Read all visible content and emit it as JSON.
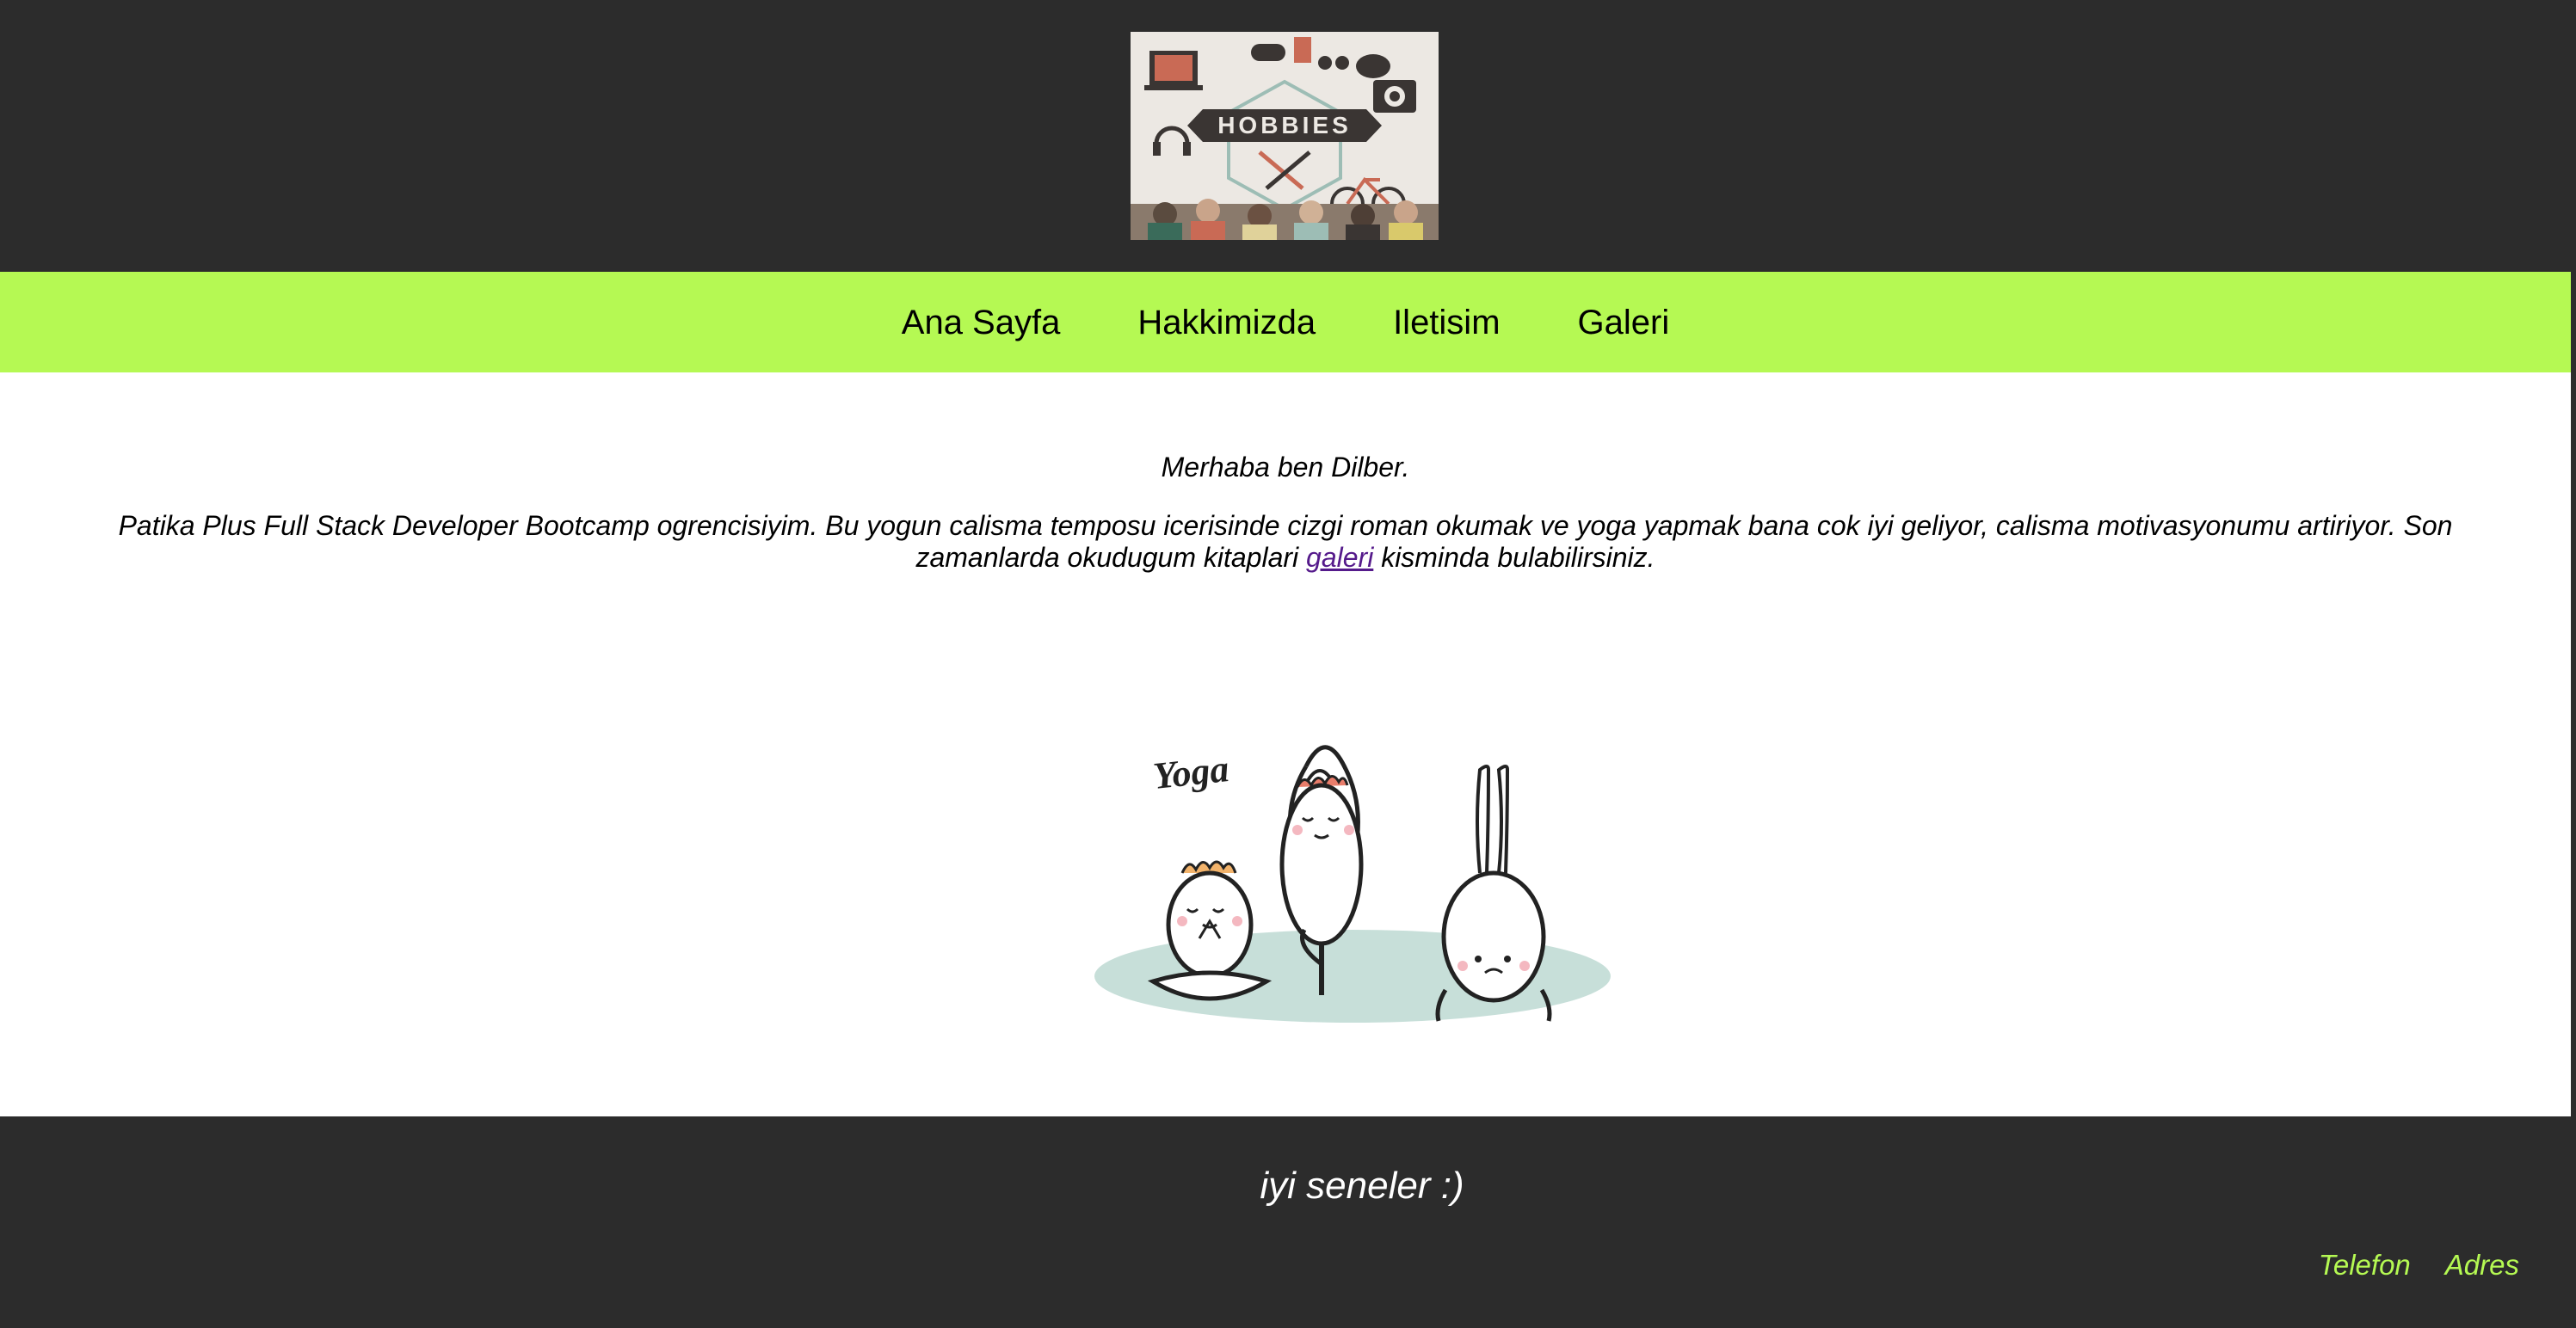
{
  "header": {
    "logo_text": "HOBBIES"
  },
  "nav": {
    "items": [
      {
        "label": "Ana Sayfa"
      },
      {
        "label": "Hakkimizda"
      },
      {
        "label": "Iletisim"
      },
      {
        "label": "Galeri"
      }
    ]
  },
  "main": {
    "greeting": "Merhaba ben Dilber.",
    "bio_before_link": "Patika Plus Full Stack Developer Bootcamp ogrencisiyim. Bu yogun calisma temposu icerisinde cizgi roman okumak ve yoga yapmak bana cok iyi geliyor, calisma motivasyonumu artiriyor. Son zamanlarda okudugum kitaplari ",
    "bio_link": "galeri",
    "bio_after_link": " kisminda bulabilirsiniz.",
    "yoga_caption": "Yoga"
  },
  "footer": {
    "message": "iyi seneler :)",
    "links": [
      {
        "label": "Telefon"
      },
      {
        "label": "Adres"
      }
    ]
  },
  "colors": {
    "header_bg": "#2c2c2c",
    "nav_bg": "#b5f953",
    "accent_green": "#b5f953",
    "link_visited": "#551a8b"
  }
}
